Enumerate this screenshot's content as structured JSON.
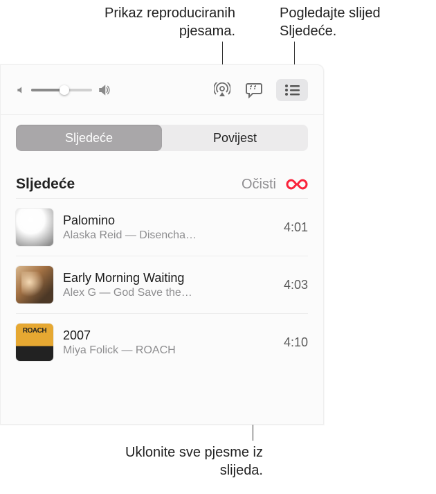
{
  "callouts": {
    "history": "Prikaz reproduciranih pjesama.",
    "queue_button": "Pogledajte slijed Sljedeće.",
    "clear": "Uklonite sve pjesme iz slijeda."
  },
  "tabs": {
    "up_next": "Sljedeće",
    "history": "Povijest"
  },
  "section": {
    "title": "Sljedeće",
    "clear_label": "Očisti"
  },
  "tracks": [
    {
      "title": "Palomino",
      "subtitle": "Alaska Reid — Disencha…",
      "duration": "4:01",
      "art_label": ""
    },
    {
      "title": "Early Morning Waiting",
      "subtitle": "Alex G — God Save the…",
      "duration": "4:03",
      "art_label": ""
    },
    {
      "title": "2007",
      "subtitle": "Miya Folick — ROACH",
      "duration": "4:10",
      "art_label": "ROACH"
    }
  ]
}
